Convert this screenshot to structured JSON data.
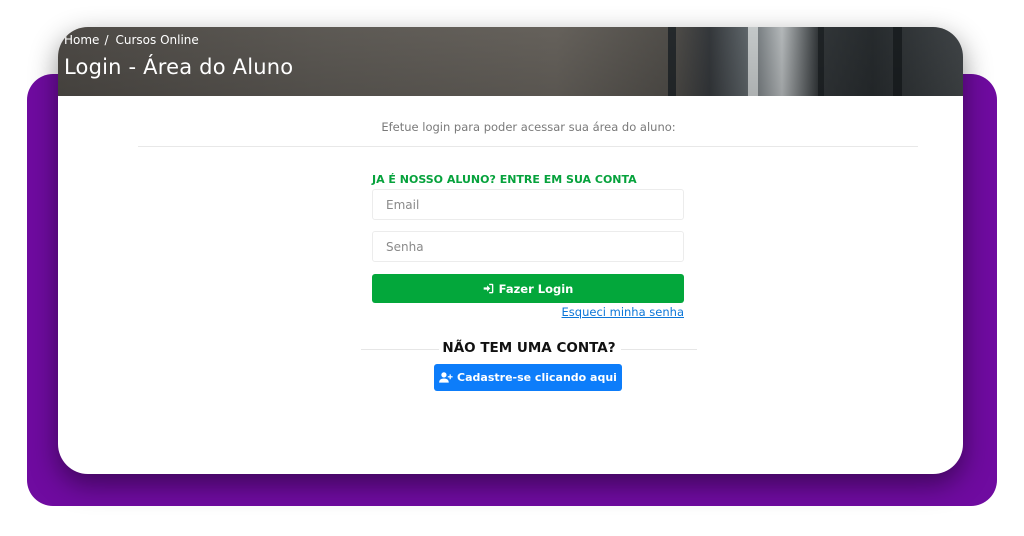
{
  "breadcrumb": {
    "home": "Home",
    "separator": "/",
    "current": "Cursos Online"
  },
  "hero": {
    "title": "Login - Área do Aluno"
  },
  "intro_text": "Efetue login para poder acessar sua área do aluno:",
  "login": {
    "heading": "JA É NOSSO ALUNO? ENTRE EM SUA CONTA",
    "email_placeholder": "Email",
    "password_placeholder": "Senha",
    "submit_label": "Fazer Login",
    "submit_icon": "sign-in-icon",
    "forgot_link": "Esqueci minha senha"
  },
  "signup": {
    "heading": "NÃO TEM UMA CONTA?",
    "button_label": "Cadastre-se clicando aqui",
    "button_icon": "user-plus-icon"
  },
  "colors": {
    "purple_backdrop": "#6f0ba0",
    "green_accent": "#03a73b",
    "blue_button": "#0d7dfa",
    "link": "#0c76d8"
  }
}
